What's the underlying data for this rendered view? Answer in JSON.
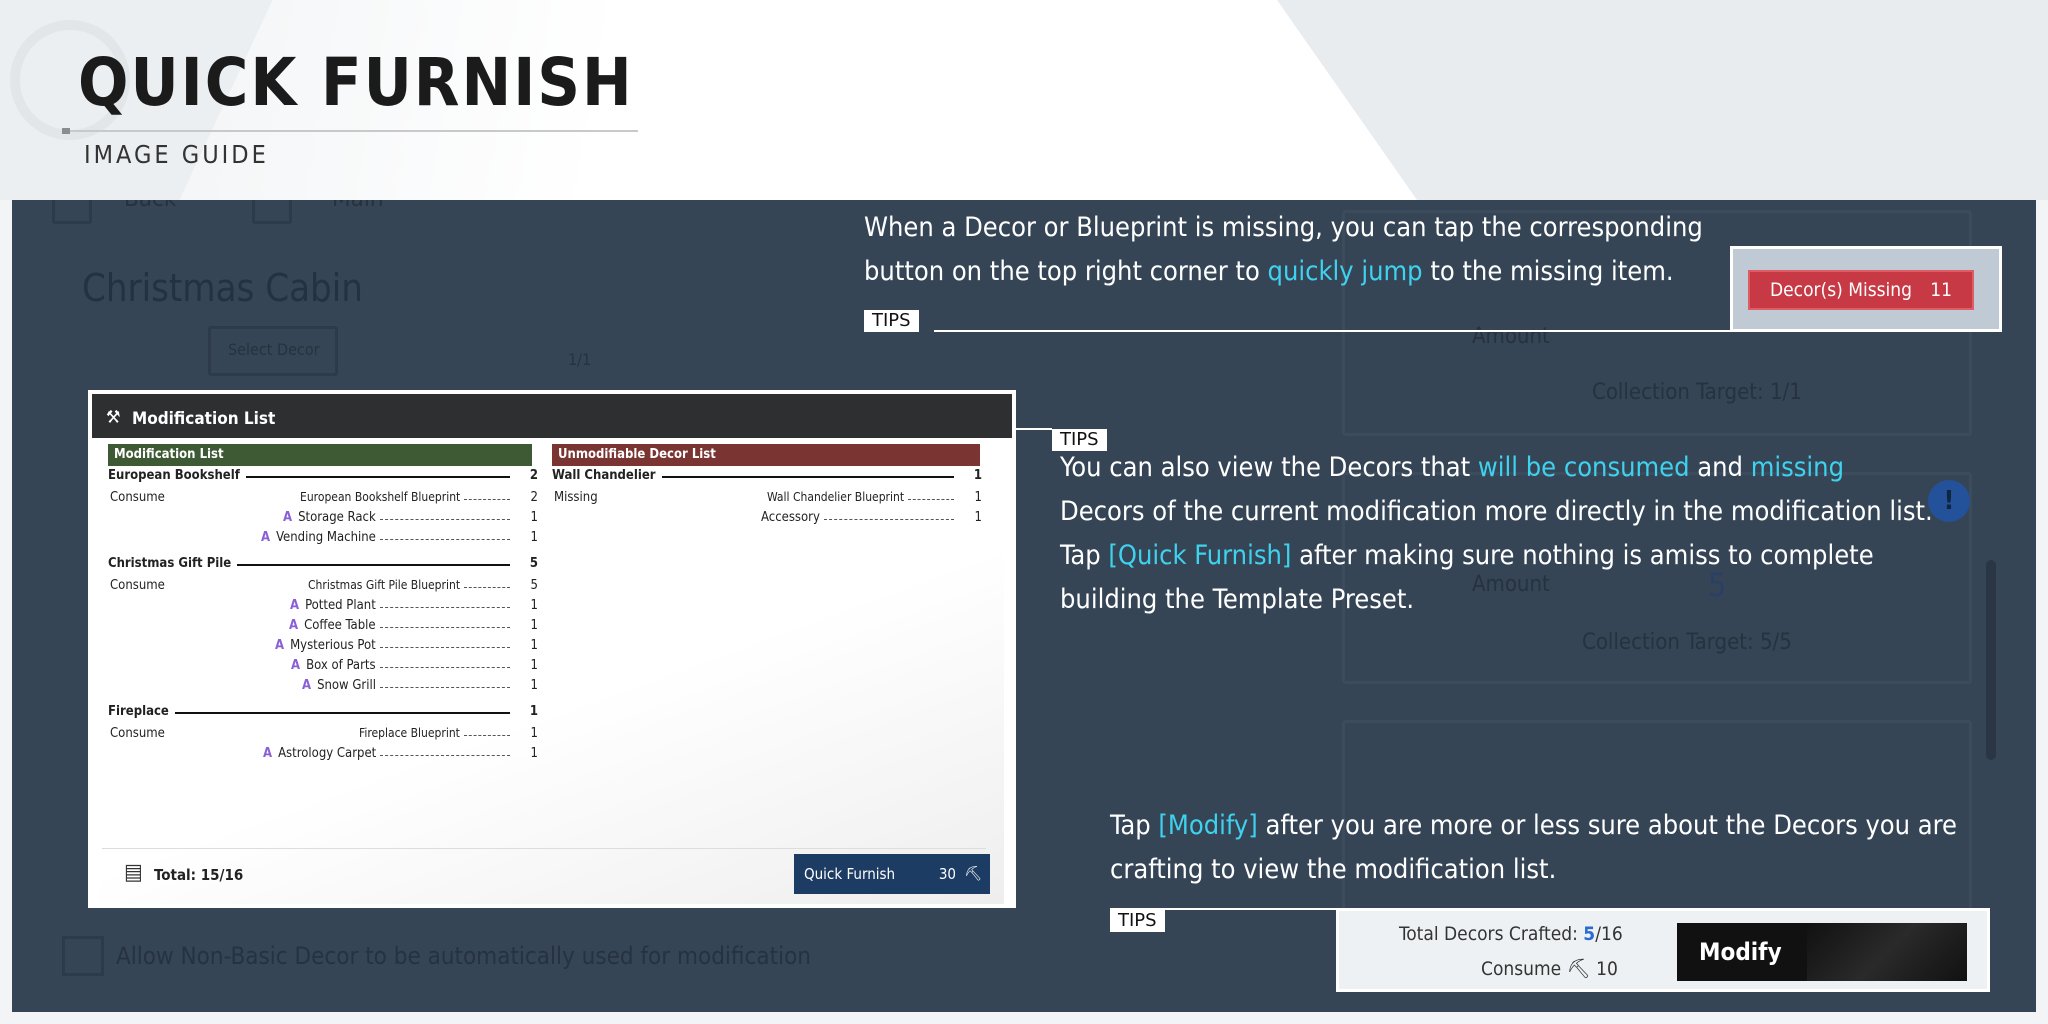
{
  "header": {
    "title": "QUICK FURNISH",
    "subtitle": "IMAGE GUIDE"
  },
  "background": {
    "back_label": "Back",
    "main_label": "Main",
    "cabin_title": "Christmas Cabin",
    "select_decor": "Select Decor",
    "slot_count": "1/1",
    "amount_label": "Amount",
    "collection_target_1": "Collection Target:  1/1",
    "collection_target_2": "Collection Target:  5/5",
    "amount_value": "5",
    "allow_label": "Allow Non-Basic Decor to be automatically used for modification"
  },
  "tips": {
    "label": "TIPS",
    "tip1": {
      "line1": "When a Decor or Blueprint is missing, you can tap the corresponding",
      "line2_pre": "button on the top right corner to ",
      "line2_hl": "quickly jump",
      "line2_post": " to the missing item."
    },
    "tip2": {
      "line1_pre": "You can also view the Decors that ",
      "line1_hl1": "will be consumed",
      "line1_mid": " and ",
      "line1_hl2": "missing",
      "line2": "Decors of the current modification more directly in the modification list.",
      "line3_pre": "Tap ",
      "line3_hl": "[Quick Furnish]",
      "line3_post": " after making sure nothing is amiss to complete",
      "line4": "building the Template Preset."
    },
    "tip3": {
      "line1_pre": "Tap ",
      "line1_hl": "[Modify]",
      "line1_post": " after you are more or less sure about the Decors you are",
      "line2": "crafting to view the modification list."
    }
  },
  "decor_missing": {
    "label": "Decor(s) Missing",
    "count": "11"
  },
  "modification_card": {
    "title": "Modification List",
    "mod_list_header": "Modification List",
    "unmod_list_header": "Unmodifiable Decor List",
    "colors": {
      "mod_header": "#3e5a34",
      "unmod_header": "#7a3432",
      "accessory_mark": "#8a5fd6"
    },
    "left_rows": [
      {
        "kind": "group",
        "label": "European Bookshelf",
        "value": "2"
      },
      {
        "kind": "consume",
        "label": "Consume",
        "item": "European Bookshelf Blueprint",
        "value": "2"
      },
      {
        "kind": "acc",
        "mark": "A",
        "item": "Storage Rack",
        "value": "1"
      },
      {
        "kind": "acc",
        "mark": "A",
        "item": "Vending Machine",
        "value": "1"
      },
      {
        "kind": "group",
        "label": "Christmas Gift Pile",
        "value": "5"
      },
      {
        "kind": "consume",
        "label": "Consume",
        "item": "Christmas Gift Pile Blueprint",
        "value": "5"
      },
      {
        "kind": "acc",
        "mark": "A",
        "item": "Potted Plant",
        "value": "1"
      },
      {
        "kind": "acc",
        "mark": "A",
        "item": "Coffee Table",
        "value": "1"
      },
      {
        "kind": "acc",
        "mark": "A",
        "item": "Mysterious Pot",
        "value": "1"
      },
      {
        "kind": "acc",
        "mark": "A",
        "item": "Box of Parts",
        "value": "1"
      },
      {
        "kind": "acc",
        "mark": "A",
        "item": "Snow Grill",
        "value": "1"
      },
      {
        "kind": "group",
        "label": "Fireplace",
        "value": "1"
      },
      {
        "kind": "consume",
        "label": "Consume",
        "item": "Fireplace Blueprint",
        "value": "1"
      },
      {
        "kind": "acc",
        "mark": "A",
        "item": "Astrology Carpet",
        "value": "1"
      }
    ],
    "right_rows": [
      {
        "kind": "group",
        "label": "Wall Chandelier",
        "value": "1"
      },
      {
        "kind": "consume",
        "label": "Missing",
        "item": "Wall Chandelier Blueprint",
        "value": "1"
      },
      {
        "kind": "plain",
        "item": "Accessory",
        "value": "1"
      }
    ],
    "total_label": "Total:",
    "total_value": "15/16",
    "quick_furnish_label": "Quick Furnish",
    "quick_furnish_cost": "30"
  },
  "modify_panel": {
    "total_label": "Total Decors Crafted: ",
    "total_done": "5",
    "total_all": "/16",
    "consume_label": "Consume",
    "consume_value": "10",
    "button_label": "Modify"
  }
}
